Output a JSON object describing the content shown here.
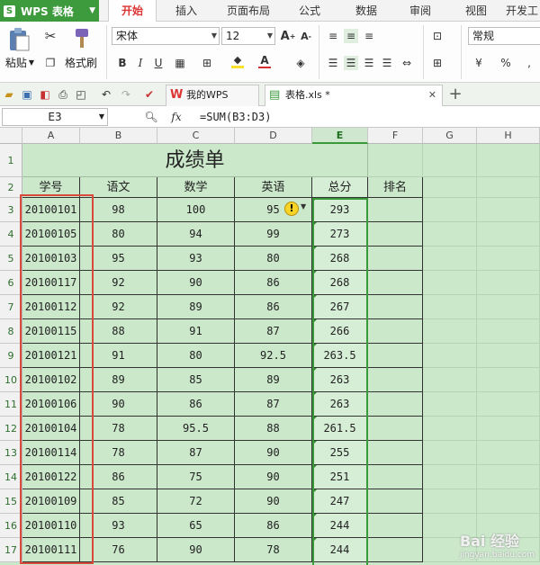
{
  "app": {
    "name": "WPS 表格",
    "logo_letter": "S"
  },
  "tabs": [
    "开始",
    "插入",
    "页面布局",
    "公式",
    "数据",
    "审阅",
    "视图",
    "开发工"
  ],
  "active_tab": "开始",
  "ribbon": {
    "paste_label": "粘贴",
    "format_painter_label": "格式刷",
    "font_name": "宋体",
    "font_size": "12",
    "number_format": "常规",
    "bold": "B",
    "italic": "I",
    "underline": "U",
    "percent": "%",
    "font_color": "#d32f2f",
    "fill_color": "#f7e02a"
  },
  "doc_tabs": [
    {
      "label": "我的WPS"
    },
    {
      "label": "表格.xls *"
    }
  ],
  "formula_bar": {
    "cell_ref": "E3",
    "fx": "fx",
    "formula": "=SUM(B3:D3)"
  },
  "columns": [
    "A",
    "B",
    "C",
    "D",
    "E",
    "F",
    "G",
    "H"
  ],
  "selected_column": "E",
  "sheet": {
    "title": "成绩单",
    "headers": [
      "学号",
      "语文",
      "数学",
      "英语",
      "总分",
      "排名"
    ],
    "rows": [
      [
        "20100101",
        "98",
        "100",
        "95",
        "293"
      ],
      [
        "20100105",
        "80",
        "94",
        "99",
        "273"
      ],
      [
        "20100103",
        "95",
        "93",
        "80",
        "268"
      ],
      [
        "20100117",
        "92",
        "90",
        "86",
        "268"
      ],
      [
        "20100112",
        "92",
        "89",
        "86",
        "267"
      ],
      [
        "20100115",
        "88",
        "91",
        "87",
        "266"
      ],
      [
        "20100121",
        "91",
        "80",
        "92.5",
        "263.5"
      ],
      [
        "20100102",
        "89",
        "85",
        "89",
        "263"
      ],
      [
        "20100106",
        "90",
        "86",
        "87",
        "263"
      ],
      [
        "20100104",
        "78",
        "95.5",
        "88",
        "261.5"
      ],
      [
        "20100114",
        "78",
        "87",
        "90",
        "255"
      ],
      [
        "20100122",
        "86",
        "75",
        "90",
        "251"
      ],
      [
        "20100109",
        "85",
        "72",
        "90",
        "247"
      ],
      [
        "20100110",
        "93",
        "65",
        "86",
        "244"
      ],
      [
        "20100111",
        "76",
        "90",
        "78",
        "244"
      ]
    ]
  },
  "row_numbers": [
    "1",
    "2",
    "3",
    "4",
    "5",
    "6",
    "7",
    "8",
    "9",
    "10",
    "11",
    "12",
    "13",
    "14",
    "15",
    "16",
    "17"
  ],
  "warning_symbol": "!",
  "watermark": {
    "text": "Bai 经验",
    "sub": "jingyan.baidu.com"
  }
}
